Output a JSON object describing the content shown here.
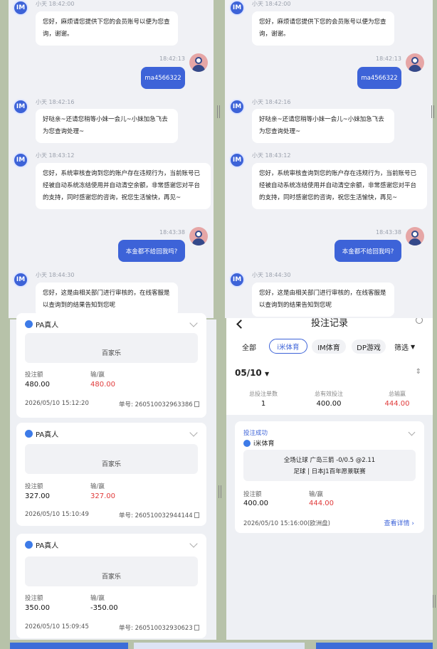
{
  "chat": {
    "msgs": [
      {
        "sender": "小天",
        "time": "18:42:00",
        "text": "您好，麻烦请您提供下您的会员账号以便为您查询，谢谢。"
      },
      {
        "sender": "小天",
        "time": "18:42:16",
        "text": "好哒亲~还请您稍等小妹一会儿~小妹加急飞去为您查询处理~"
      },
      {
        "sender": "小天",
        "time": "18:43:12",
        "text": "您好，系统审核查询到您的账户存在违规行为，当前账号已经被自动系统冻结使用并自动清空余额，非常感谢您对平台的支持，同时感谢您的咨询，祝您生活愉快，再见~"
      },
      {
        "sender": "小天",
        "time": "18:44:30",
        "text": "您好，这是由相关部门进行审核的，在线客服是以查询到的结果告知到您呢"
      }
    ],
    "user_msgs": [
      {
        "time": "18:42:13",
        "text": "ma4566322"
      },
      {
        "time": "18:43:38",
        "text": "本金都不给回我吗?"
      }
    ],
    "avatar_label": "IM"
  },
  "records": {
    "cards": [
      {
        "platform": "PA真人",
        "game": "百家乐",
        "bet_label": "投注额",
        "bet": "480.00",
        "win_label": "输/赢",
        "win": "480.00",
        "datetime": "2026/05/10 15:12:20",
        "order_label": "单号:",
        "order": "260510032963386"
      },
      {
        "platform": "PA真人",
        "game": "百家乐",
        "bet_label": "投注额",
        "bet": "327.00",
        "win_label": "输/赢",
        "win": "327.00",
        "datetime": "2026/05/10 15:10:49",
        "order_label": "单号:",
        "order": "260510032944144"
      },
      {
        "platform": "PA真人",
        "game": "百家乐",
        "bet_label": "投注额",
        "bet": "350.00",
        "win_label": "输/赢",
        "win": "-350.00",
        "datetime": "2026/05/10 15:09:45",
        "order_label": "单号:",
        "order": "260510032930623"
      }
    ]
  },
  "betlog": {
    "title": "投注记录",
    "tabs": [
      "全部",
      "i米体育",
      "IM体育",
      "DP游戏"
    ],
    "filter": "筛选",
    "date": "05/10",
    "stats": [
      {
        "label": "总投注单数",
        "value": "1"
      },
      {
        "label": "总有效投注",
        "value": "400.00"
      },
      {
        "label": "总输赢",
        "value": "444.00"
      }
    ],
    "detail": {
      "status": "投注成功",
      "platform": "i米体育",
      "line1": "全场让球 广岛三箭 -0/0.5 @2.11",
      "line2": "足球 | 日本J1百年愿景联赛",
      "bet_label": "投注额",
      "bet": "400.00",
      "win_label": "输/赢",
      "win": "444.00",
      "datetime": "2026/05/10 15:16:00(欧洲盘)",
      "link": "查看详情"
    }
  },
  "colors": {
    "accent": "#3d63d8",
    "loss": "#e03a3a"
  }
}
